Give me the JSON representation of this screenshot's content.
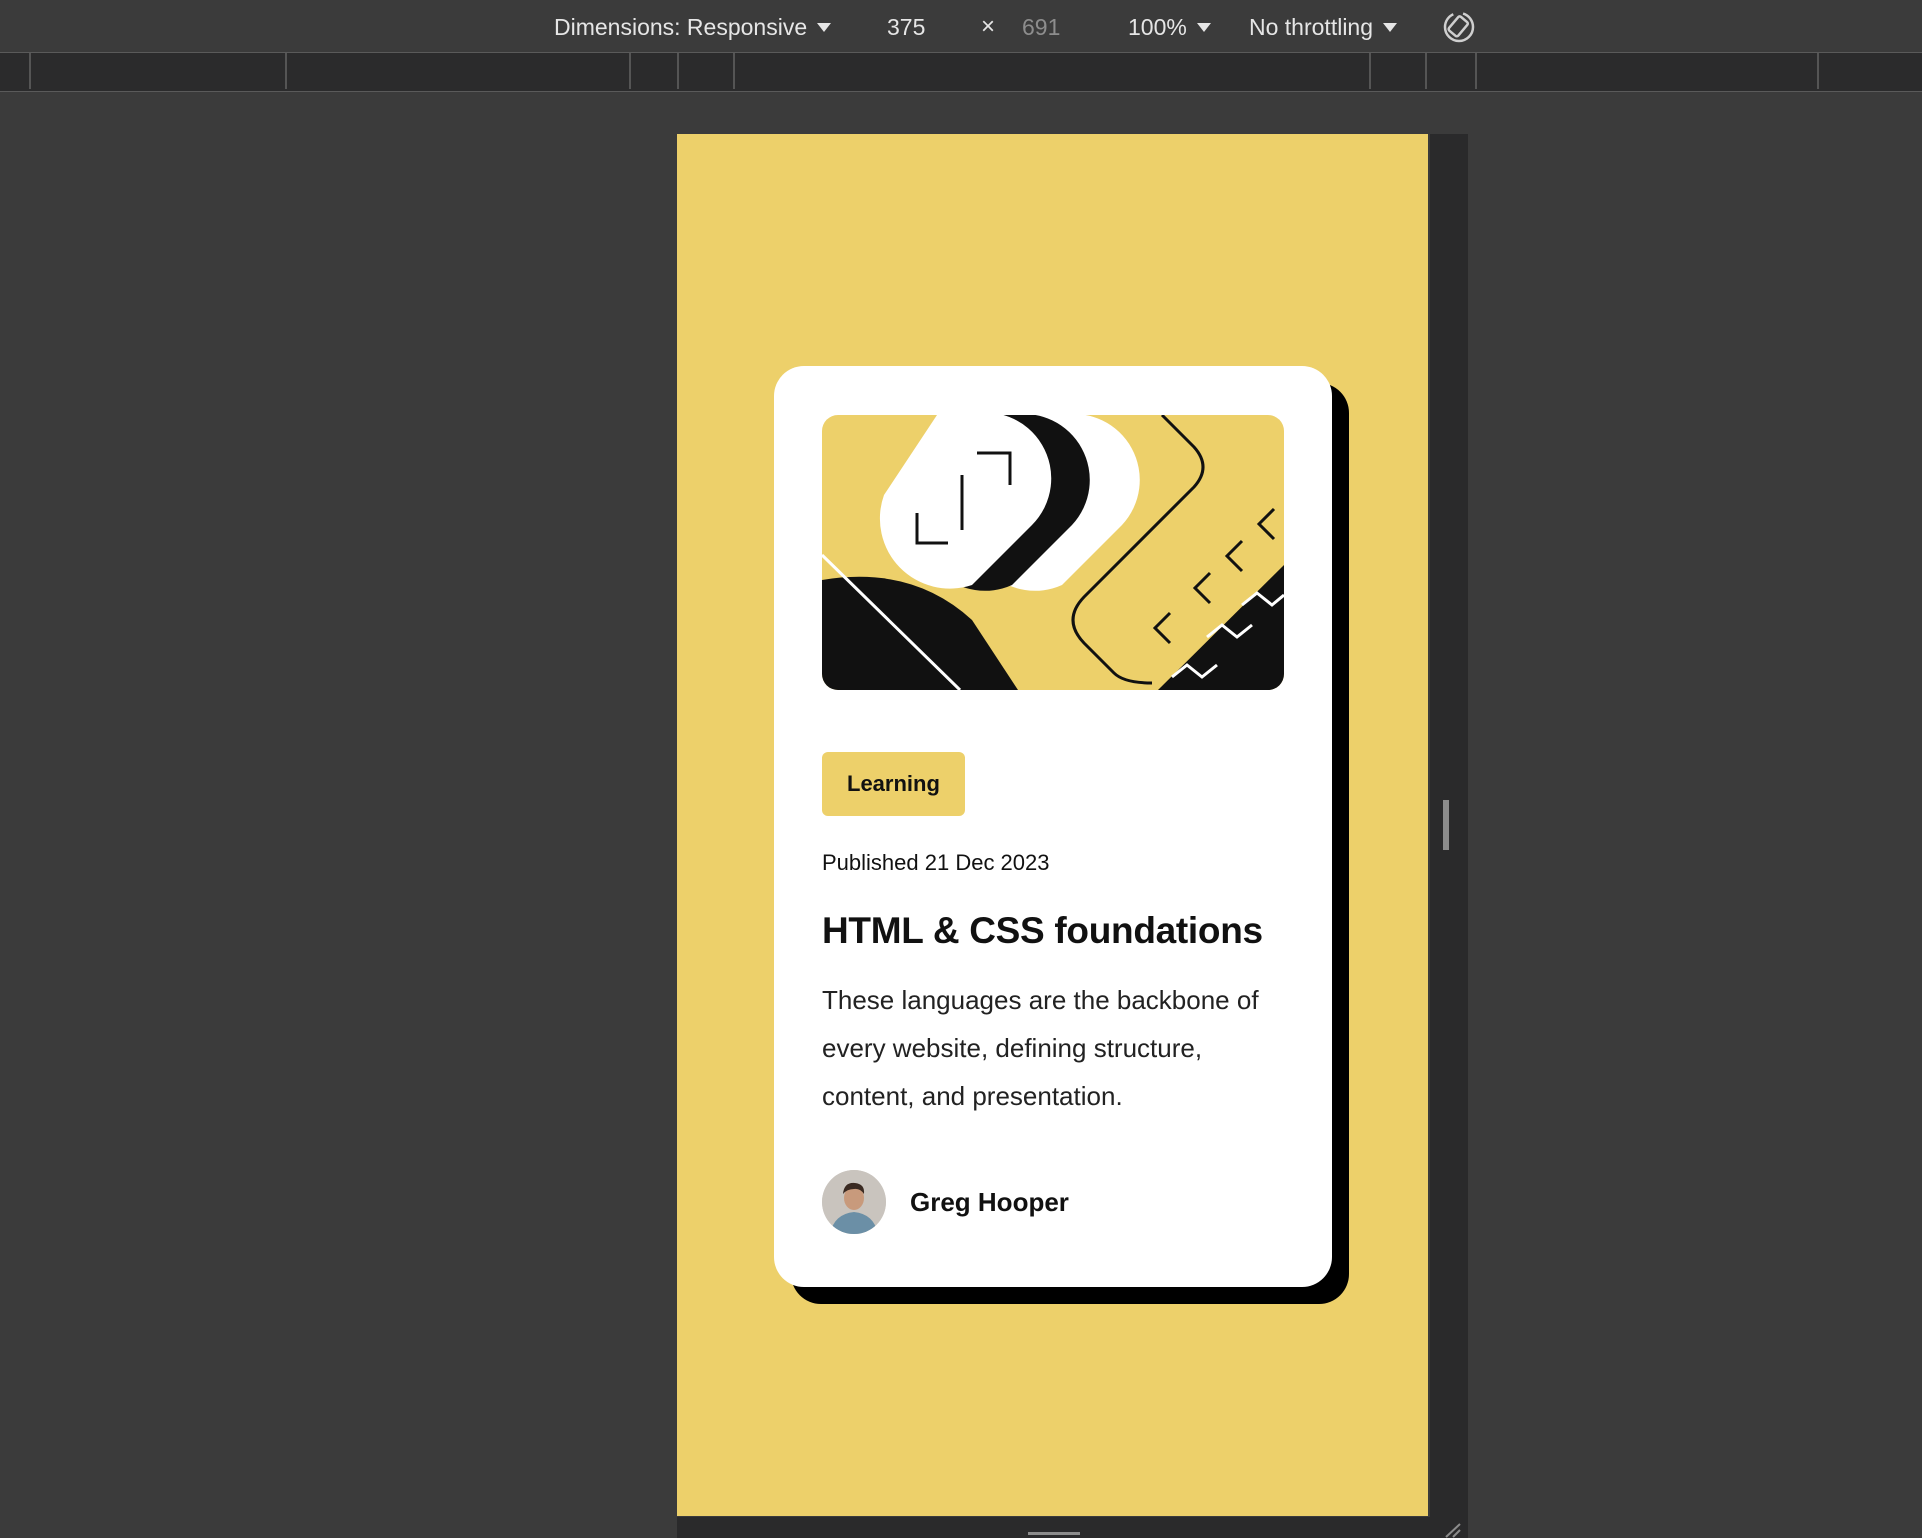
{
  "toolbar": {
    "dimensions_label": "Dimensions: Responsive",
    "width_value": "375",
    "times_symbol": "×",
    "height_value": "691",
    "zoom_value": "100%",
    "throttling_value": "No throttling",
    "rotate_icon": "rotate-icon"
  },
  "card": {
    "tag": "Learning",
    "published": "Published 21 Dec 2023",
    "title": "HTML & CSS foundations",
    "description": "These languages are the backbone of every website, defining structure, content, and presentation.",
    "author_name": "Greg Hooper"
  },
  "colors": {
    "accent_yellow": "#EDD06A",
    "card_bg": "#FFFFFF",
    "shadow": "#000000",
    "devtools_bg": "#3B3B3B"
  }
}
